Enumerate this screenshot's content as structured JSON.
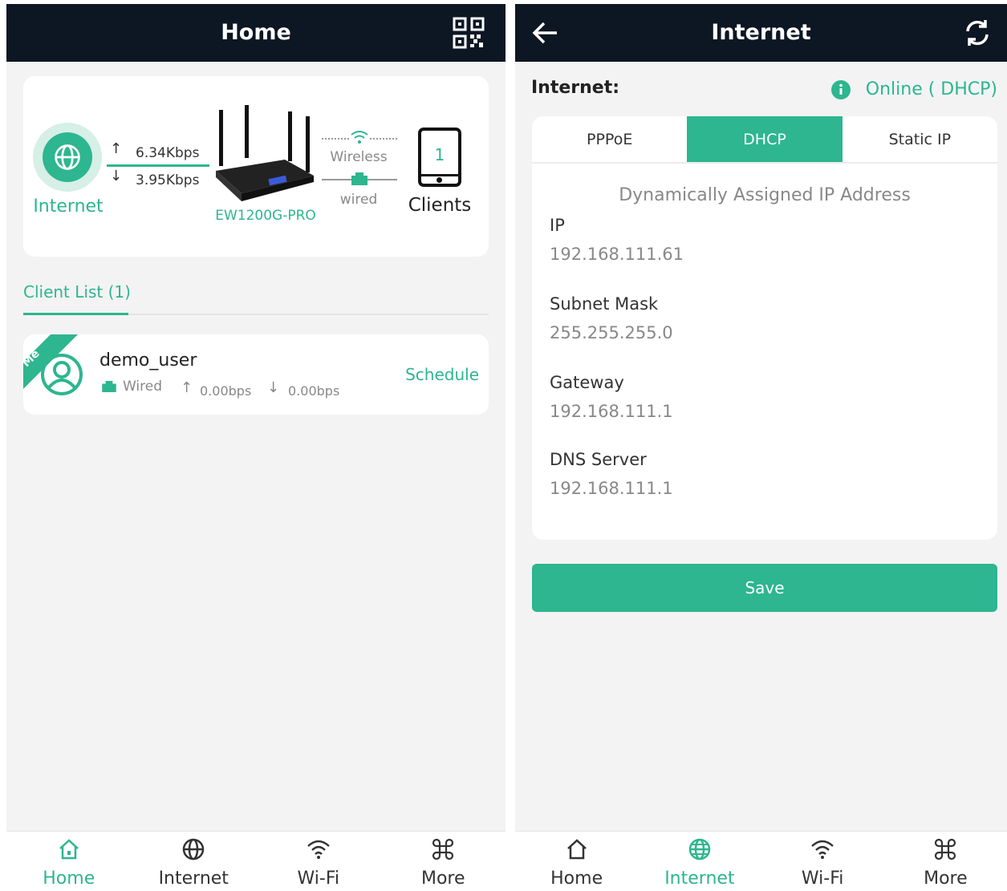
{
  "colors": {
    "accent": "#2db68f",
    "header_bg": "#0d1623",
    "page_bg": "#f3f3f3"
  },
  "home": {
    "title": "Home",
    "topology": {
      "internet_label": "Internet",
      "up_rate": "6.34Kbps",
      "down_rate": "3.95Kbps",
      "router_model": "EW1200G-PRO",
      "wireless_label": "Wireless",
      "wired_label": "wired",
      "clients_count": "1",
      "clients_label": "Clients"
    },
    "client_list_tab": "Client List (1)",
    "client": {
      "badge": "Me",
      "name": "demo_user",
      "connection": "Wired",
      "up": "0.00bps",
      "down": "0.00bps",
      "action": "Schedule"
    }
  },
  "internet": {
    "title": "Internet",
    "label": "Internet:",
    "status": "Online ( DHCP)",
    "modes": [
      "PPPoE",
      "DHCP",
      "Static IP"
    ],
    "selected_mode": "DHCP",
    "section_title": "Dynamically Assigned IP Address",
    "fields": [
      {
        "label": "IP",
        "value": "192.168.111.61"
      },
      {
        "label": "Subnet Mask",
        "value": "255.255.255.0"
      },
      {
        "label": "Gateway",
        "value": "192.168.111.1"
      },
      {
        "label": "DNS Server",
        "value": "192.168.111.1"
      }
    ],
    "save_label": "Save"
  },
  "nav": [
    "Home",
    "Internet",
    "Wi-Fi",
    "More"
  ]
}
